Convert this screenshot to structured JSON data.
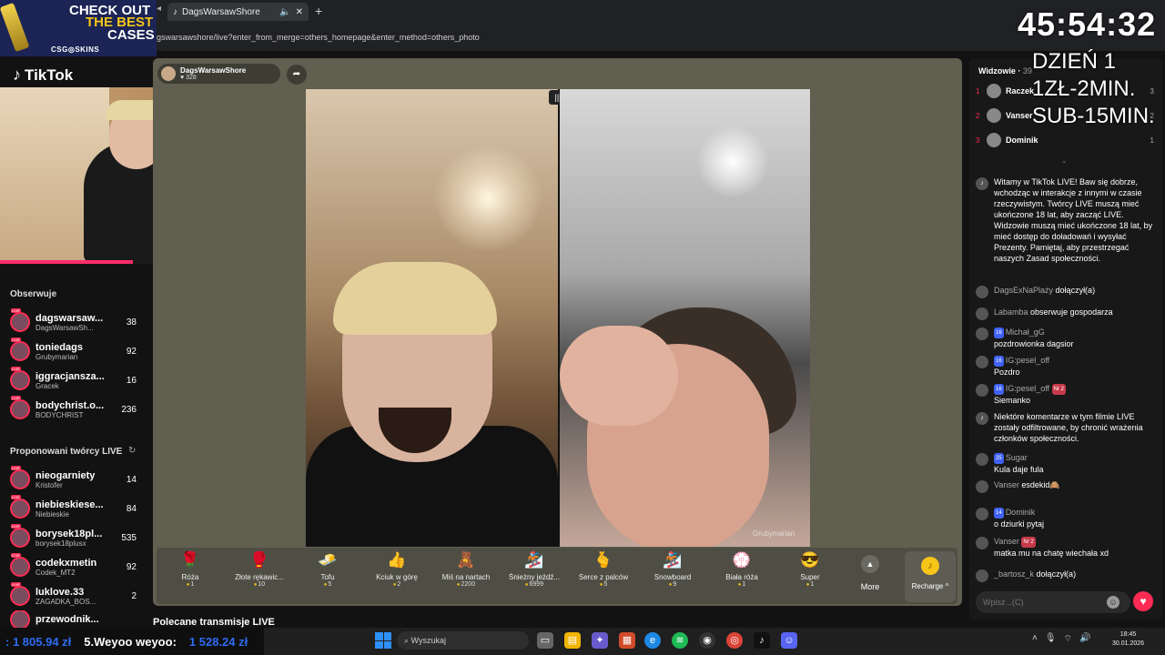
{
  "ad": {
    "line1": "CHECK OUT",
    "line2": "THE BEST",
    "line3": "CASES",
    "brand": "CSG◎SKINS"
  },
  "browser": {
    "tab_title": "DagsWarsawShore",
    "url": "gswarsawshore/live?enter_from_merge=others_homepage&enter_method=others_photo"
  },
  "brand": {
    "logo": "TikTok"
  },
  "following": {
    "title": "Obserwuje",
    "items": [
      {
        "name": "dagswarsaw...",
        "sub": "DagsWarsawSh...",
        "count": "38"
      },
      {
        "name": "toniedags",
        "sub": "Grubymarian",
        "count": "92"
      },
      {
        "name": "iggracjansza...",
        "sub": "Gracek",
        "count": "16"
      },
      {
        "name": "bodychrist.o...",
        "sub": "BODYCHRIST",
        "count": "236"
      }
    ]
  },
  "suggested": {
    "title": "Proponowani twórcy LIVE",
    "items": [
      {
        "name": "nieogarniety",
        "sub": "Kristofer",
        "count": "14"
      },
      {
        "name": "niebieskiese...",
        "sub": "Niebieskie",
        "count": "84"
      },
      {
        "name": "borysek18pl...",
        "sub": "borysek18plusx",
        "count": "535"
      },
      {
        "name": "codekxmetin",
        "sub": "Codek_MT2",
        "count": "92"
      },
      {
        "name": "luklove.33",
        "sub": "ZAGADKA_BOS...",
        "count": "2"
      },
      {
        "name": "przewodnik...",
        "sub": "",
        "count": ""
      }
    ]
  },
  "stream": {
    "host_name": "DagsWarsawShore",
    "host_likes": "328",
    "guest_label": "Grubymarian",
    "recommended": "Polecane transmisje LIVE"
  },
  "gifts": [
    {
      "name": "Róża",
      "price": "1",
      "icon": "🌹"
    },
    {
      "name": "Złote rękawic...",
      "price": "10",
      "icon": "🥊"
    },
    {
      "name": "Tofu",
      "price": "5",
      "icon": "🧈"
    },
    {
      "name": "Kciuk w górę",
      "price": "2",
      "icon": "👍"
    },
    {
      "name": "Miś na nartach",
      "price": "2200",
      "icon": "🧸"
    },
    {
      "name": "Śnieżny jeźdź...",
      "price": "6999",
      "icon": "🏂"
    },
    {
      "name": "Serce z palców",
      "price": "5",
      "icon": "🫰"
    },
    {
      "name": "Snowboard",
      "price": "9",
      "icon": "🏂"
    },
    {
      "name": "Biała róża",
      "price": "1",
      "icon": "💮"
    },
    {
      "name": "Super",
      "price": "1",
      "icon": "😎"
    }
  ],
  "gift_actions": {
    "more": "More",
    "recharge": "Recharge"
  },
  "viewers": {
    "title": "Widzowie",
    "count": "39",
    "items": [
      {
        "rank": "1",
        "name": "Raczek",
        "score": "3"
      },
      {
        "rank": "2",
        "name": "Vanser",
        "score": "2"
      },
      {
        "rank": "3",
        "name": "Dominik",
        "score": "1"
      }
    ]
  },
  "chat": [
    {
      "name": "",
      "text": "Witamy w TikTok LIVE! Baw się dobrze, wchodząc w interakcje z innymi w czasie rzeczywistym. Twórcy LIVE muszą mieć ukończone 18 lat, aby zacząć LIVE. Widzowie muszą mieć ukończone 18 lat, by mieć dostęp do doładowań i wysyłać Prezenty. Pamiętaj, aby przestrzegać naszych Zasad społeczności."
    },
    {
      "name": "DagsExNaPlaży",
      "text": "dołączył(a)"
    },
    {
      "name": "Labamba",
      "text": "obserwuje gospodarza"
    },
    {
      "name": "Michał_gG",
      "level": "16",
      "text": "pozdrowionka dagsior"
    },
    {
      "name": "IG:pesel_off",
      "level": "16",
      "text": "Pozdro"
    },
    {
      "name": "IG:pesel_off",
      "level": "16",
      "nr": "Nr 2",
      "text": "Siemanko"
    },
    {
      "name": "",
      "text": "Niektóre komentarze w tym filmie LIVE zostały odfiltrowane, by chronić wrażenia członków społeczności."
    },
    {
      "name": "Sugar",
      "level": "25",
      "text": "Kula daje fula"
    },
    {
      "name": "Vanser",
      "text": "esdekid🙈"
    },
    {
      "name": "Dominik",
      "level": "14",
      "text": "o dziurki pytaj"
    },
    {
      "name": "Vanser",
      "nr": "Nr 2",
      "text": "matka mu na chatę wiechała xd"
    },
    {
      "name": "_bartosz_k",
      "text": "dołączył(a)"
    }
  ],
  "chat_input": {
    "placeholder": "Wpisz...(C)"
  },
  "overlay": {
    "timer": "45:54:32",
    "day": "DZIEŃ 1",
    "rate1": "1ZŁ-2MIN.",
    "rate2": "SUB-15MIN."
  },
  "ticker": {
    "amount1": ": 1 805.94 zł",
    "text": "5.Weyoo weyoo:",
    "amount2": "1 528.24 zł"
  },
  "taskbar": {
    "search": "Wyszukaj",
    "time": "18:45",
    "date": "30.01.2026"
  },
  "colors": {
    "accent": "#fe2c55",
    "panel": "#605f50",
    "ticker_blue": "#2e6cf2"
  }
}
